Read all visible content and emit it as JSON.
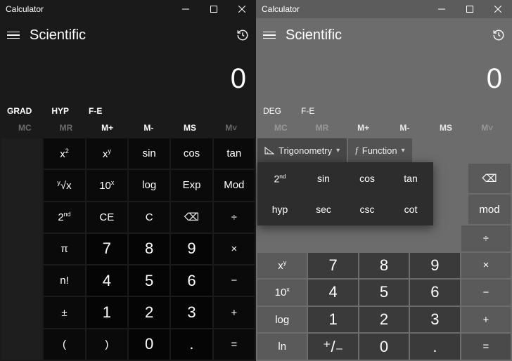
{
  "left": {
    "app_title": "Calculator",
    "mode": "Scientific",
    "display": "0",
    "modes": {
      "angle": "GRAD",
      "hyp": "HYP",
      "fe": "F-E"
    },
    "mem": {
      "mc": "MC",
      "mr": "MR",
      "mplus": "M+",
      "mminus": "M-",
      "ms": "MS",
      "mlist": "M˅"
    },
    "keys": {
      "x2": "x²",
      "xy": "xʸ",
      "sin": "sin",
      "cos": "cos",
      "tan": "tan",
      "yroot": "ʸ√x",
      "tenx": "10ˣ",
      "log": "log",
      "exp": "Exp",
      "mod": "Mod",
      "second": "2ⁿᵈ",
      "ce": "CE",
      "c": "C",
      "back": "⌫",
      "div": "÷",
      "pi": "π",
      "k7": "7",
      "k8": "8",
      "k9": "9",
      "mul": "×",
      "fact": "n!",
      "k4": "4",
      "k5": "5",
      "k6": "6",
      "sub": "−",
      "neg": "±",
      "k1": "1",
      "k2": "2",
      "k3": "3",
      "add": "+",
      "lp": "(",
      "rp": ")",
      "k0": "0",
      "dot": ".",
      "eq": "="
    }
  },
  "right": {
    "app_title": "Calculator",
    "mode": "Scientific",
    "display": "0",
    "modes": {
      "angle": "DEG",
      "fe": "F-E"
    },
    "mem": {
      "mc": "MC",
      "mr": "MR",
      "mplus": "M+",
      "mminus": "M-",
      "ms": "MS",
      "mlist": "M˅"
    },
    "dropdowns": {
      "trig": "Trigonometry",
      "func": "Function"
    },
    "popup": {
      "second": "2ⁿᵈ",
      "sin": "sin",
      "cos": "cos",
      "tan": "tan",
      "hyp": "hyp",
      "sec": "sec",
      "csc": "csc",
      "cot": "cot"
    },
    "keys": {
      "back": "⌫",
      "mod": "mod",
      "div": "÷",
      "xy": "xʸ",
      "k7": "7",
      "k8": "8",
      "k9": "9",
      "mul": "×",
      "tenx": "10ˣ",
      "k4": "4",
      "k5": "5",
      "k6": "6",
      "sub": "−",
      "log": "log",
      "k1": "1",
      "k2": "2",
      "k3": "3",
      "add": "+",
      "ln": "ln",
      "neg": "⁺/₋",
      "k0": "0",
      "dot": ".",
      "eq": "="
    }
  }
}
